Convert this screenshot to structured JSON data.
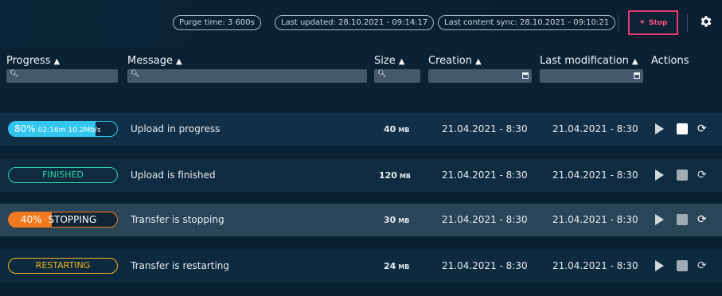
{
  "topbar": {
    "purge_time": "Purge time: 3 600s",
    "last_updated": "Last updated: 28.10.2021 - 09:14:17",
    "last_sync": "Last content sync: 28.10.2021 - 09:10:21",
    "stop_label": "Stop"
  },
  "columns": {
    "progress": "Progress",
    "message": "Message",
    "size": "Size",
    "creation": "Creation",
    "last_modification": "Last modification",
    "actions": "Actions"
  },
  "rows": [
    {
      "status": "uploading",
      "progress_percent": 80,
      "progress_label": "80%",
      "time_left": "02:16m",
      "speed": "10.2Mb/s",
      "message": "Upload in progress",
      "size": "40",
      "size_unit": "MB",
      "creation": "21.04.2021 - 8:30",
      "modified": "21.04.2021 - 8:30"
    },
    {
      "status": "finished",
      "progress_label": "FINISHED",
      "message": "Upload is finished",
      "size": "120",
      "size_unit": "MB",
      "creation": "21.04.2021 - 8:30",
      "modified": "21.04.2021 - 8:30"
    },
    {
      "status": "stopping",
      "progress_percent": 40,
      "progress_label": "40%",
      "state_label": "STOPPING",
      "message": "Transfer is stopping",
      "size": "30",
      "size_unit": "MB",
      "creation": "21.04.2021 - 8:30",
      "modified": "21.04.2021 - 8:30"
    },
    {
      "status": "restarting",
      "progress_label": "RESTARTING",
      "message": "Transfer is restarting",
      "size": "24",
      "size_unit": "MB",
      "creation": "21.04.2021 - 8:30",
      "modified": "21.04.2021 - 8:30"
    }
  ],
  "colors": {
    "uploading": "#32c6ee",
    "finished": "#2fd4a8",
    "stopping": "#f07a20",
    "restarting": "#f0b520",
    "stop_accent": "#e33a6e"
  },
  "icons": [
    "search-icon",
    "calendar-icon",
    "sort-icon",
    "stop-icon",
    "gear-icon",
    "play-icon",
    "stop-square-icon",
    "restart-icon"
  ]
}
